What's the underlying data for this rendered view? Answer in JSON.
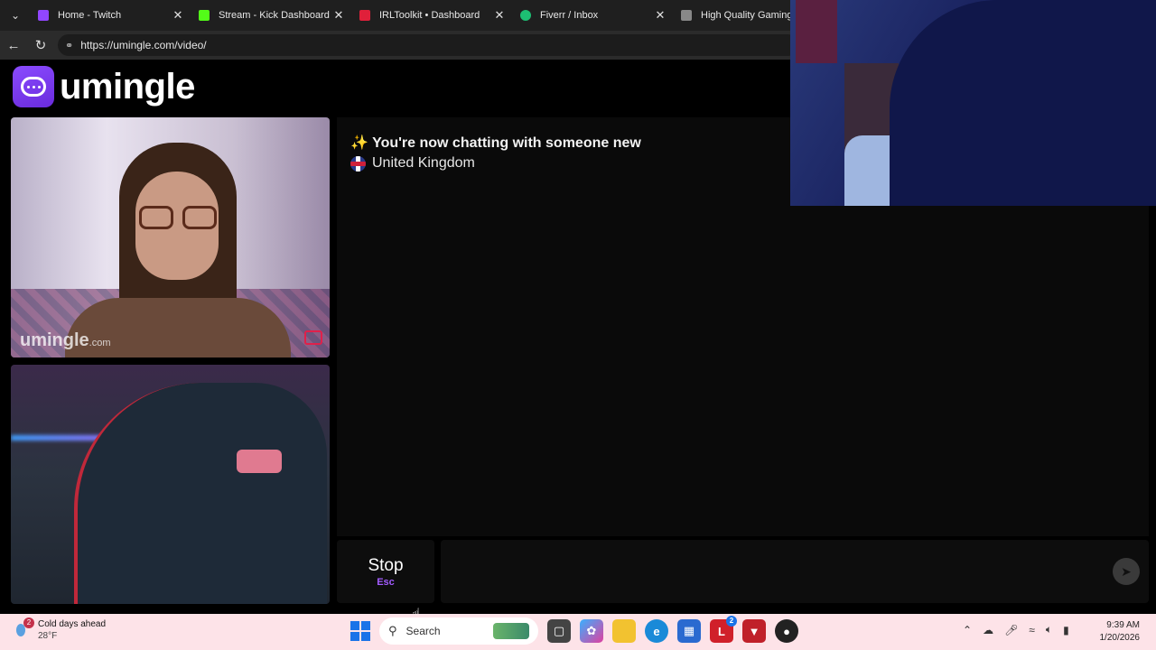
{
  "browser": {
    "tabs": [
      {
        "label": "Home - Twitch",
        "icon": "twitch-icon",
        "color": "#9146ff"
      },
      {
        "label": "Stream - Kick Dashboard",
        "icon": "kick-icon",
        "color": "#53fc18"
      },
      {
        "label": "IRLToolkit • Dashboard",
        "icon": "irltoolkit-icon",
        "color": "#e0203a"
      },
      {
        "label": "Fiverr / Inbox",
        "icon": "fiverr-icon",
        "color": "#1dbf73"
      },
      {
        "label": "High Quality Gaming Ge",
        "icon": "generic-site-icon",
        "color": "#888888"
      }
    ],
    "url": "https://umingle.com/video/"
  },
  "site": {
    "logo_text": "umingle",
    "brand_color": "#7b3cf0"
  },
  "stranger_video": {
    "watermark": "umingle",
    "watermark_suffix": ".com"
  },
  "chat": {
    "status_emoji": "✨",
    "status_text": "You're now chatting with someone new",
    "country": "United Kingdom"
  },
  "controls": {
    "stop_label": "Stop",
    "stop_shortcut": "Esc",
    "message_placeholder": ""
  },
  "taskbar": {
    "weather_badge": "2",
    "weather_line1": "Cold days ahead",
    "weather_line2": "28°F",
    "search_label": "Search",
    "store_badge": "2",
    "time": "9:39 AM",
    "date": "1/20/2026"
  }
}
